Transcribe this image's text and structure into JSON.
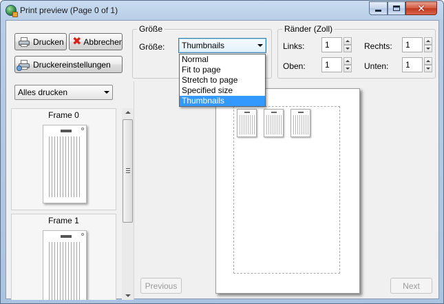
{
  "window": {
    "title": "Print preview (Page 0 of 1)"
  },
  "toolbar": {
    "print_label": "Drucken",
    "cancel_label": "Abbrechen",
    "printer_settings_label": "Druckereinstellungen"
  },
  "size_group": {
    "legend": "Größe",
    "label": "Größe:",
    "selected": "Thumbnails",
    "options": [
      "Normal",
      "Fit to page",
      "Stretch to page",
      "Specified size",
      "Thumbnails"
    ]
  },
  "margins_group": {
    "legend": "Ränder (Zoll)",
    "left_label": "Links:",
    "left_value": "1",
    "right_label": "Rechts:",
    "right_value": "1",
    "top_label": "Oben:",
    "top_value": "1",
    "bottom_label": "Unten:",
    "bottom_value": "1"
  },
  "print_scope": {
    "selected": "Alles drucken"
  },
  "frames": [
    {
      "label": "Frame 0"
    },
    {
      "label": "Frame 1"
    }
  ],
  "navigation": {
    "previous_label": "Previous",
    "next_label": "Next"
  },
  "colors": {
    "selection": "#3399ff",
    "close_button": "#c0391f"
  }
}
